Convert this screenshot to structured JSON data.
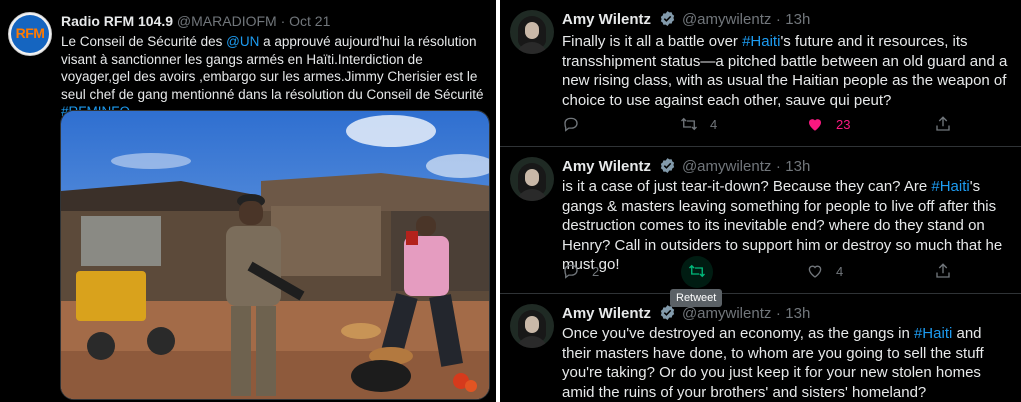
{
  "left_tweet": {
    "account_name": "Radio RFM 104.9",
    "handle": "@MARADIOFM",
    "date": "Oct 21",
    "avatar_logo": "RFM",
    "text_1": "Le Conseil de Sécurité des ",
    "mention": "@UN",
    "text_2": " a approuvé aujourd'hui la résolution visant à sanctionner les gangs armés en Haïti.Interdiction de voyager,gel des avoirs ,embargo sur les armes.Jimmy Cherisier est le seul chef de gang mentionné dans la résolution du Conseil de Sécurité ",
    "hashtag": "#RFMINFO",
    "photo_description": "news-photo-market-scene"
  },
  "right_tweets": [
    {
      "name": "Amy Wilentz",
      "handle": "@amywilentz",
      "time": "13h",
      "text_1": "Finally is it all a battle over ",
      "hashtag": "#Haiti",
      "text_2": "'s future and it resources, its transshipment status—a pitched battle between an old guard and a new rising class, with as usual the Haitian people as the weapon of choice to use against each other, sauve qui peut?",
      "replies": "",
      "retweets": "4",
      "likes": "23"
    },
    {
      "name": "Amy Wilentz",
      "handle": "@amywilentz",
      "time": "13h",
      "text_1": "is it a case of just tear-it-down? Because they can? Are ",
      "hashtag": "#Haiti",
      "text_2": "'s gangs & masters leaving something for people to live off after this destruction comes to its inevitable end? where do they stand on Henry? Call in outsiders to support him or destroy so much that he must go!",
      "replies": "2",
      "retweets": "",
      "likes": "4",
      "tooltip": "Retweet"
    },
    {
      "name": "Amy Wilentz",
      "handle": "@amywilentz",
      "time": "13h",
      "text_1": "Once you've destroyed an economy, as the gangs in ",
      "hashtag": "#Haiti",
      "text_2": " and their masters have done, to whom are you going to sell the stuff you're taking? Or do you just keep it for your new stolen homes amid the ruins of your brothers' and sisters' homeland?"
    }
  ],
  "separator": "·",
  "colors": {
    "background": "#000000",
    "text": "#e7e9ea",
    "secondary": "#71767b",
    "link": "#1d9bf0",
    "like": "#f91880",
    "retweet": "#00ba7c",
    "verified": "#829aab"
  },
  "icons": [
    "reply-icon",
    "retweet-icon",
    "like-icon",
    "share-icon",
    "verified-icon"
  ]
}
